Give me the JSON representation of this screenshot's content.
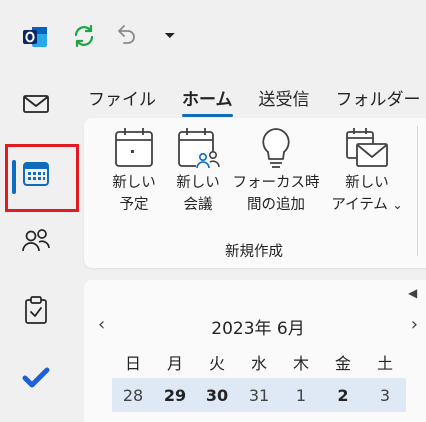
{
  "app": {
    "name": "Outlook",
    "accent": "#0f6cbd",
    "highlight": "#e01b22"
  },
  "titlebar": {
    "icons": [
      "outlook-logo",
      "sync-icon",
      "undo-icon",
      "customize-toolbar-icon"
    ],
    "customize_glyph": "⏷"
  },
  "rail": {
    "items": [
      {
        "name": "mail",
        "icon": "mail-icon"
      },
      {
        "name": "calendar",
        "icon": "calendar-icon",
        "active": true
      },
      {
        "name": "people",
        "icon": "people-icon"
      },
      {
        "name": "tasks",
        "icon": "tasks-icon"
      },
      {
        "name": "todo",
        "icon": "todo-check-icon"
      }
    ]
  },
  "tabs": [
    {
      "label": "ファイル"
    },
    {
      "label": "ホーム",
      "active": true
    },
    {
      "label": "送受信"
    },
    {
      "label": "フォルダー"
    }
  ],
  "ribbon": {
    "buttons": [
      {
        "line1": "新しい",
        "line2": "予定",
        "icon": "new-appointment-icon"
      },
      {
        "line1": "新しい",
        "line2": "会議",
        "icon": "new-meeting-icon"
      },
      {
        "line1": "フォーカス時",
        "line2": "間の追加",
        "icon": "lightbulb-icon"
      },
      {
        "line1": "新しい",
        "line2": "アイテム",
        "icon": "new-items-icon",
        "dropdown": "⌄"
      }
    ],
    "group_label": "新規作成"
  },
  "calendar": {
    "collapse_glyph": "◀",
    "prev_glyph": "‹",
    "next_glyph": "›",
    "month_label": "2023年 6月",
    "weekdays": [
      "日",
      "月",
      "火",
      "水",
      "木",
      "金",
      "土"
    ],
    "week": [
      {
        "day": "28",
        "current_month": false
      },
      {
        "day": "29",
        "current_month": true
      },
      {
        "day": "30",
        "current_month": true
      },
      {
        "day": "31",
        "current_month": false
      },
      {
        "day": "1",
        "current_month": false
      },
      {
        "day": "2",
        "current_month": true
      },
      {
        "day": "3",
        "current_month": false
      }
    ]
  }
}
